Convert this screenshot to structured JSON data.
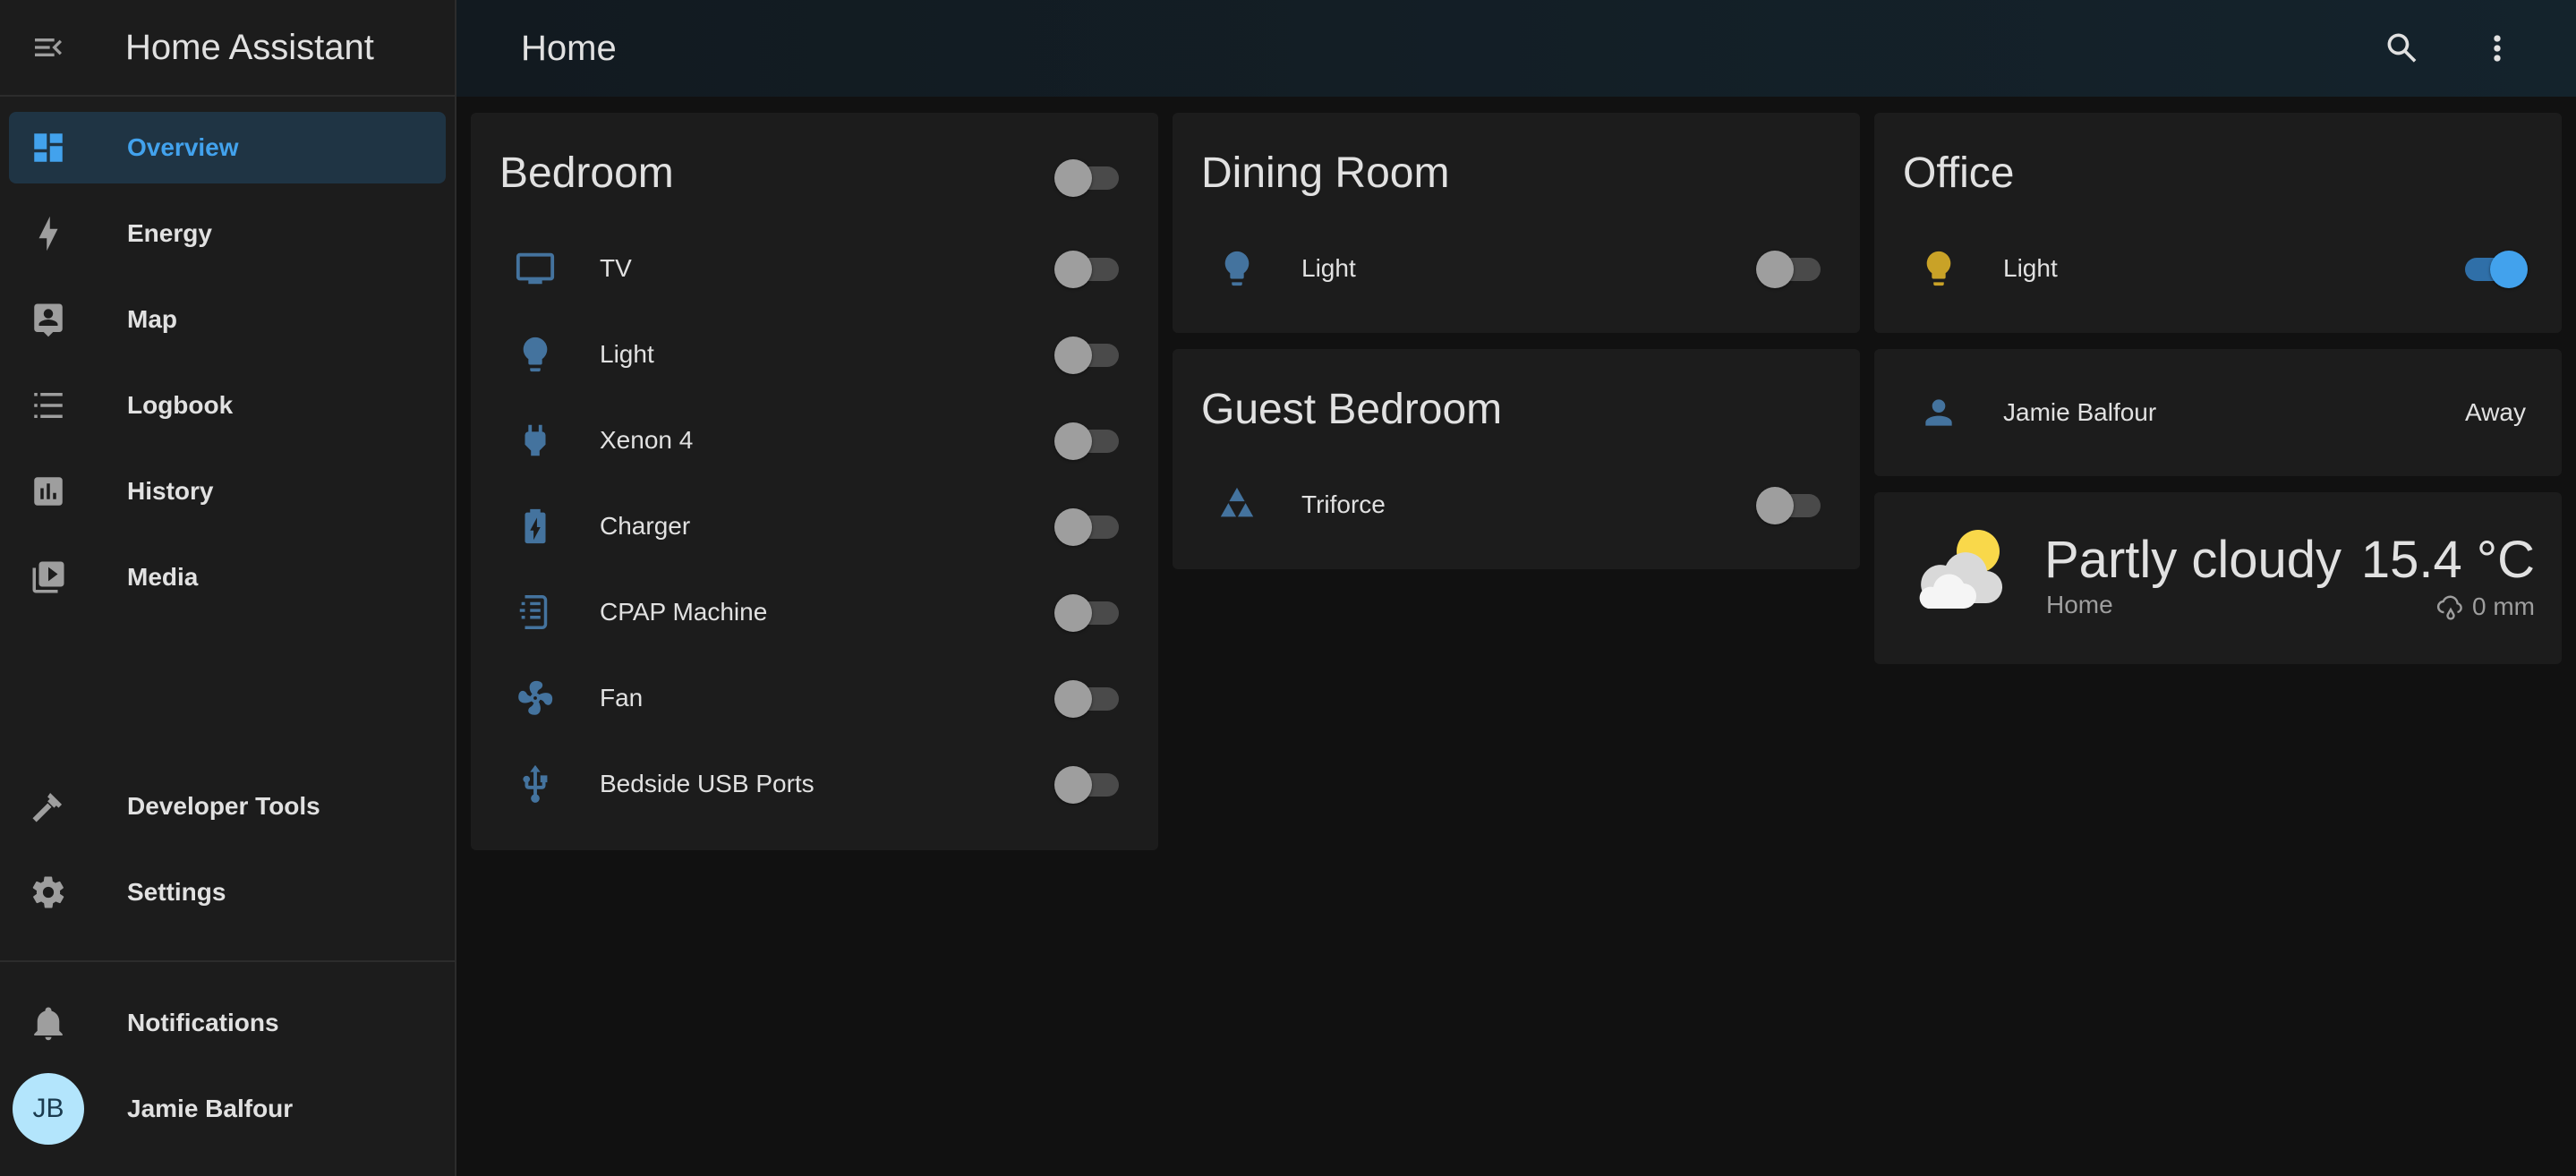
{
  "app": {
    "title": "Home Assistant"
  },
  "sidebar": {
    "items": [
      {
        "label": "Overview",
        "icon": "overview-icon",
        "active": true
      },
      {
        "label": "Energy",
        "icon": "lightning-icon"
      },
      {
        "label": "Map",
        "icon": "map-account-icon"
      },
      {
        "label": "Logbook",
        "icon": "logbook-icon"
      },
      {
        "label": "History",
        "icon": "history-chart-icon"
      },
      {
        "label": "Media",
        "icon": "media-play-icon"
      }
    ],
    "bottom_items": [
      {
        "label": "Developer Tools",
        "icon": "hammer-icon"
      },
      {
        "label": "Settings",
        "icon": "gear-icon"
      }
    ],
    "notifications": {
      "label": "Notifications",
      "icon": "bell-icon"
    },
    "user": {
      "initials": "JB",
      "name": "Jamie Balfour"
    }
  },
  "topbar": {
    "title": "Home"
  },
  "cards": {
    "bedroom": {
      "title": "Bedroom",
      "header_toggle": false,
      "entities": [
        {
          "name": "TV",
          "icon": "television-icon",
          "on": false
        },
        {
          "name": "Light",
          "icon": "lightbulb-icon",
          "on": false
        },
        {
          "name": "Xenon 4",
          "icon": "power-plug-icon",
          "on": false
        },
        {
          "name": "Charger",
          "icon": "battery-charging-icon",
          "on": false
        },
        {
          "name": "CPAP Machine",
          "icon": "air-filter-icon",
          "on": false
        },
        {
          "name": "Fan",
          "icon": "fan-icon",
          "on": false
        },
        {
          "name": "Bedside USB Ports",
          "icon": "usb-icon",
          "on": false
        }
      ]
    },
    "dining_room": {
      "title": "Dining Room",
      "entities": [
        {
          "name": "Light",
          "icon": "lightbulb-icon",
          "on": false
        }
      ]
    },
    "guest_bedroom": {
      "title": "Guest Bedroom",
      "entities": [
        {
          "name": "Triforce",
          "icon": "triforce-icon",
          "on": false
        }
      ]
    },
    "office": {
      "title": "Office",
      "entities": [
        {
          "name": "Light",
          "icon": "lightbulb-icon",
          "on": true
        }
      ]
    },
    "person": {
      "name": "Jamie Balfour",
      "state": "Away",
      "icon": "account-icon"
    },
    "weather": {
      "state": "Partly cloudy",
      "location": "Home",
      "temperature": "15.4 °C",
      "precipitation": "0 mm",
      "icon": "partly-cloudy-icon"
    }
  },
  "colors": {
    "accent": "#42a2ed",
    "icon_off": "#44739e",
    "icon_on": "#c9a227",
    "background": "#111111",
    "card": "#1c1c1c"
  }
}
